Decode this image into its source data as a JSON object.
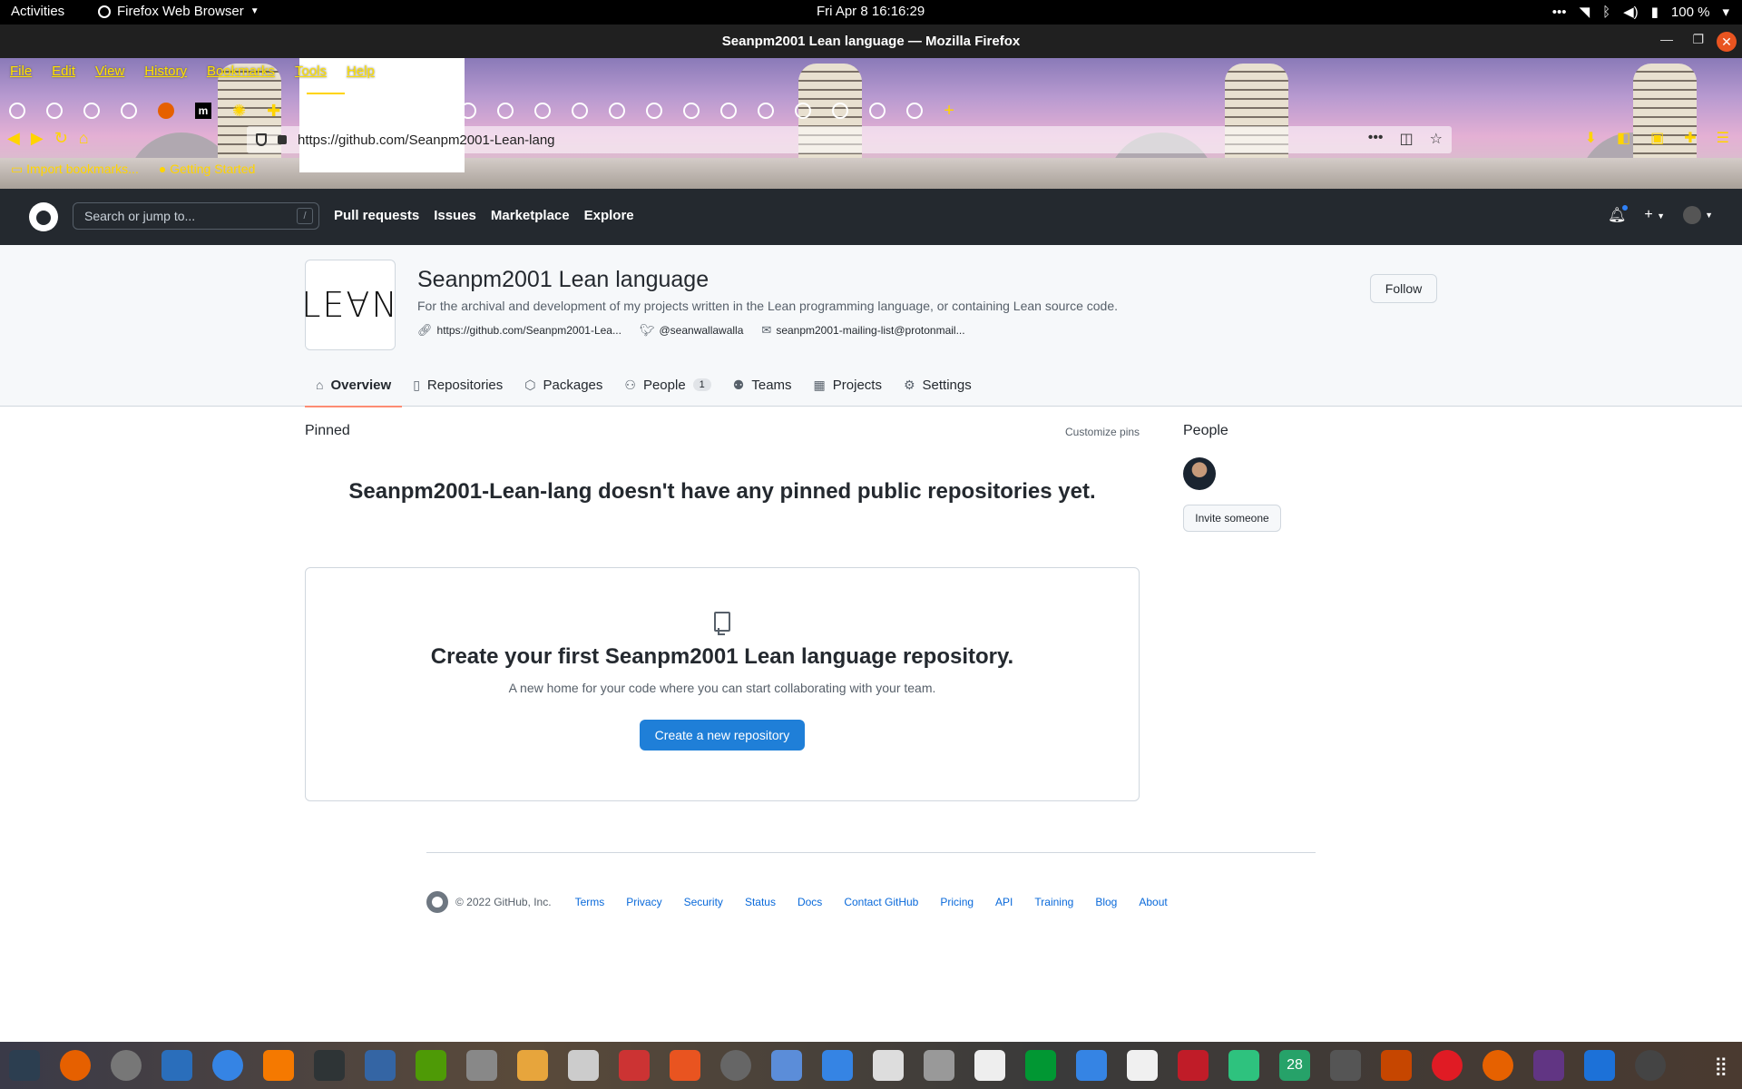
{
  "system_bar": {
    "activities": "Activities",
    "app_menu": "Firefox Web Browser",
    "clock": "Fri Apr 8  16:16:29",
    "battery": "100 %"
  },
  "window": {
    "title": "Seanpm2001 Lean language — Mozilla Firefox"
  },
  "browser": {
    "menu": [
      "File",
      "Edit",
      "View",
      "History",
      "Bookmarks",
      "Tools",
      "Help"
    ],
    "url": "https://github.com/Seanpm2001-Lean-lang",
    "bookmarks": [
      "Import bookmarks...",
      "Getting Started"
    ]
  },
  "github_header": {
    "search_placeholder": "Search or jump to...",
    "search_shortcut": "/",
    "nav": [
      "Pull requests",
      "Issues",
      "Marketplace",
      "Explore"
    ]
  },
  "org": {
    "logo_text": "LE∀N",
    "name": "Seanpm2001 Lean language",
    "description": "For the archival and development of my projects written in the Lean programming language, or containing Lean source code.",
    "website": "https://github.com/Seanpm2001-Lea...",
    "twitter": "@seanwallawalla",
    "email": "seanpm2001-mailing-list@protonmail...",
    "follow_label": "Follow",
    "tabs": [
      {
        "label": "Overview"
      },
      {
        "label": "Repositories"
      },
      {
        "label": "Packages"
      },
      {
        "label": "People",
        "count": "1"
      },
      {
        "label": "Teams"
      },
      {
        "label": "Projects"
      },
      {
        "label": "Settings"
      }
    ]
  },
  "main": {
    "pinned_heading": "Pinned",
    "customize_pins": "Customize pins",
    "no_pinned_message": "Seanpm2001-Lean-lang doesn't have any pinned public repositories yet.",
    "blankslate_title": "Create your first Seanpm2001 Lean language repository.",
    "blankslate_text": "A new home for your code where you can start collaborating with your team.",
    "create_button": "Create a new repository"
  },
  "sidebar": {
    "people_heading": "People",
    "invite_button": "Invite someone"
  },
  "footer": {
    "copyright": "© 2022 GitHub, Inc.",
    "links": [
      "Terms",
      "Privacy",
      "Security",
      "Status",
      "Docs",
      "Contact GitHub",
      "Pricing",
      "API",
      "Training",
      "Blog",
      "About"
    ]
  },
  "dock": {
    "calendar_day": "28"
  },
  "colors": {
    "github_header_bg": "#24292f",
    "primary_button": "#1f7fd8",
    "link": "#0969da",
    "active_tab_underline": "#fd8c73",
    "theme_accent": "#ffd400"
  }
}
